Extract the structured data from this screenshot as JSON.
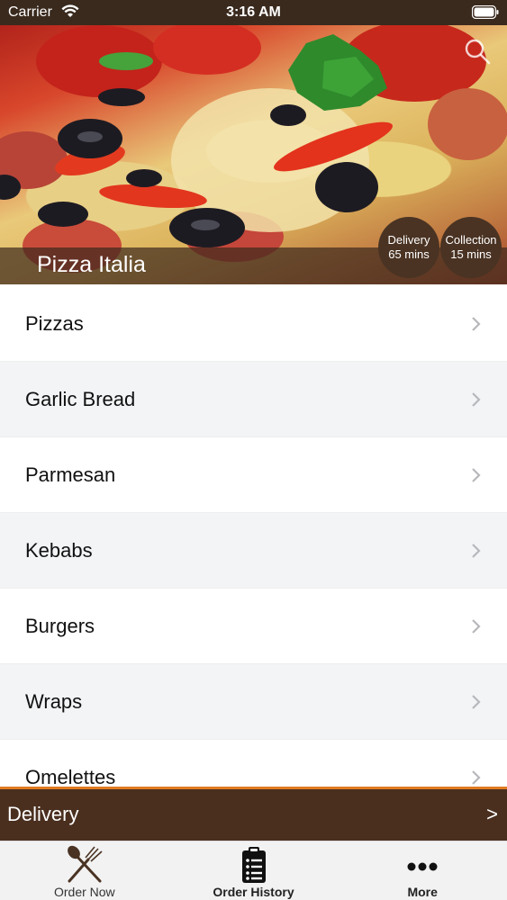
{
  "status_bar": {
    "carrier": "Carrier",
    "time": "3:16 AM"
  },
  "header": {
    "restaurant_name": "Pizza Italia",
    "delivery_badge": {
      "label": "Delivery",
      "time": "65 mins"
    },
    "collection_badge": {
      "label": "Collection",
      "time": "15 mins"
    },
    "search_icon": "search-icon"
  },
  "menu": {
    "categories": [
      {
        "label": "Pizzas"
      },
      {
        "label": "Garlic Bread"
      },
      {
        "label": "Parmesan"
      },
      {
        "label": "Kebabs"
      },
      {
        "label": "Burgers"
      },
      {
        "label": "Wraps"
      },
      {
        "label": "Omelettes"
      }
    ]
  },
  "order_bar": {
    "label": "Delivery",
    "arrow": ">"
  },
  "tabs": [
    {
      "label": "Order Now",
      "icon": "fork-knife-icon"
    },
    {
      "label": "Order History",
      "icon": "clipboard-list-icon"
    },
    {
      "label": "More",
      "icon": "more-dots-icon"
    }
  ],
  "colors": {
    "status_bar": "#3a2a1e",
    "badge": "#4a3323",
    "delivery_bar": "#4a2f1f",
    "accent": "#e07b22",
    "alt_row": "#f2f4f6"
  }
}
